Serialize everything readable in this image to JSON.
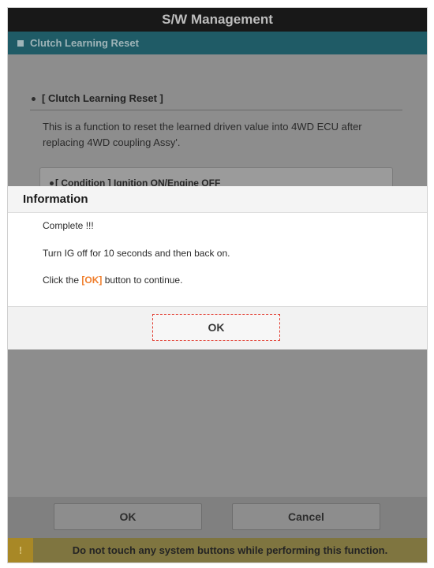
{
  "window": {
    "title": "S/W Management"
  },
  "subheader": {
    "title": "Clutch Learning Reset"
  },
  "section": {
    "title": "[ Clutch Learning Reset ]",
    "description": "This is a function to reset the learned driven value into 4WD ECU after replacing 4WD coupling Assy'.",
    "condition": "[ Condition ] Ignition ON/Engine OFF"
  },
  "dialog": {
    "title": "Information",
    "line1": "Complete !!!",
    "line2": "Turn IG off for 10 seconds and then back on.",
    "line3_before": "Click the ",
    "line3_highlight": "[OK]",
    "line3_after": " button to continue.",
    "ok_label": "OK"
  },
  "footer": {
    "ok_label": "OK",
    "cancel_label": "Cancel"
  },
  "warning": {
    "icon": "!",
    "text": "Do not touch any system buttons while performing this function."
  },
  "colors": {
    "titlebar": "#181818",
    "subheader": "#1f5b66",
    "overlay": "#8d8d8d",
    "highlight": "#f07e2c",
    "focus_border": "#e23a2e",
    "warning_bar": "#7f7540"
  }
}
